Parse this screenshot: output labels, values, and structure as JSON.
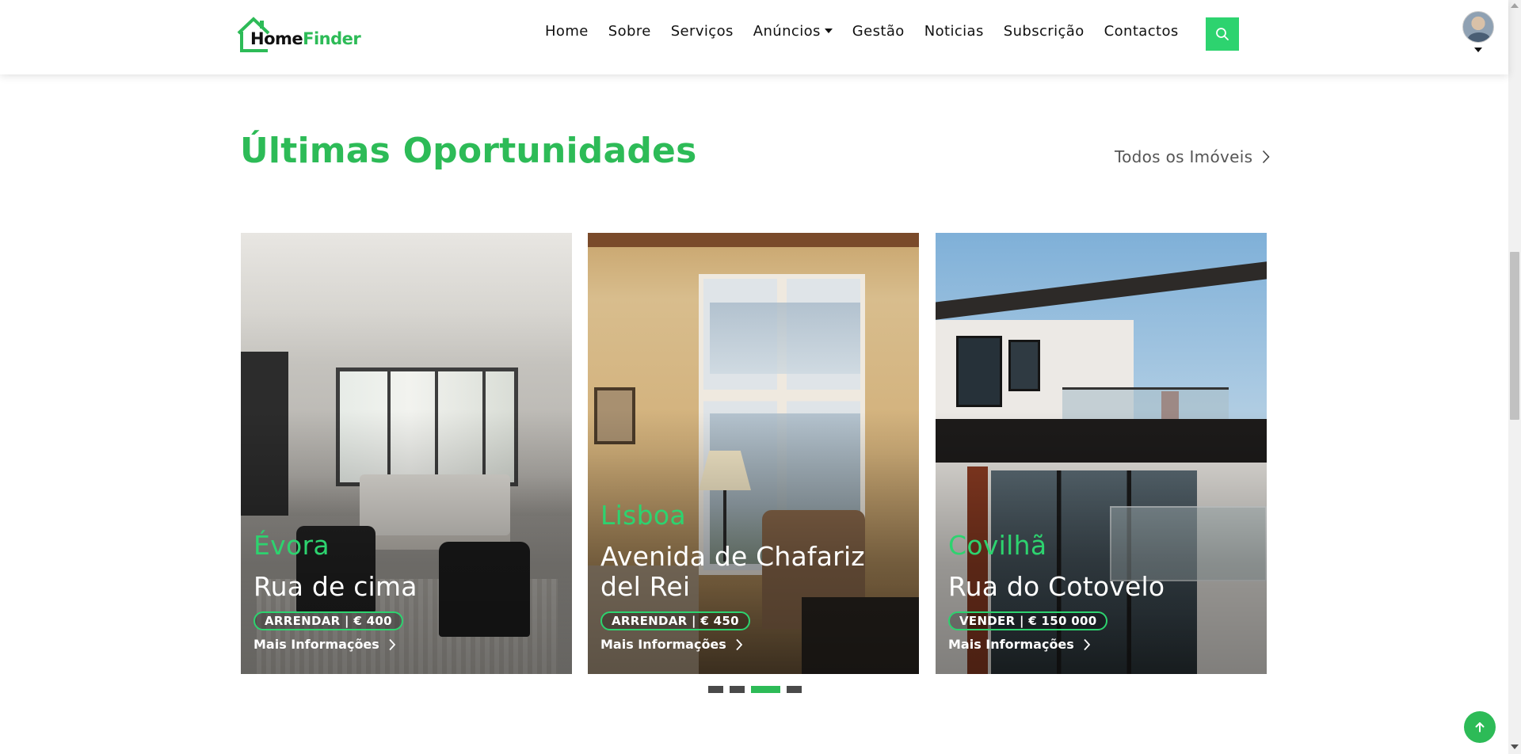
{
  "nav": {
    "logo": {
      "part1": "Home",
      "part2": "Finder"
    },
    "items": [
      {
        "label": "Home"
      },
      {
        "label": "Sobre"
      },
      {
        "label": "Serviços"
      },
      {
        "label": "Anúncios",
        "dropdown": true
      },
      {
        "label": "Gestão"
      },
      {
        "label": "Noticias"
      },
      {
        "label": "Subscrição"
      },
      {
        "label": "Contactos"
      }
    ],
    "search_icon": "search-icon",
    "avatar_icon": "user-avatar",
    "accent": "#2dd36f"
  },
  "section": {
    "title": "Últimas Oportunidades",
    "all_link": "Todos os Imóveis",
    "accent": "#2dbb57"
  },
  "cards": [
    {
      "city": "Évora",
      "street": "Rua de cima",
      "badge": "ARRENDAR | € 400",
      "more": "Mais Informações"
    },
    {
      "city": "Lisboa",
      "street": "Avenida de Chafariz del Rei",
      "badge": "ARRENDAR | € 450",
      "more": "Mais Informações"
    },
    {
      "city": "Covilhã",
      "street": "Rua do Cotovelo",
      "badge": "VENDER | € 150 000",
      "more": "Mais Informações"
    }
  ],
  "carousel": {
    "pages": 4,
    "active_page": 3
  },
  "back_to_top_icon": "arrow-up-icon"
}
